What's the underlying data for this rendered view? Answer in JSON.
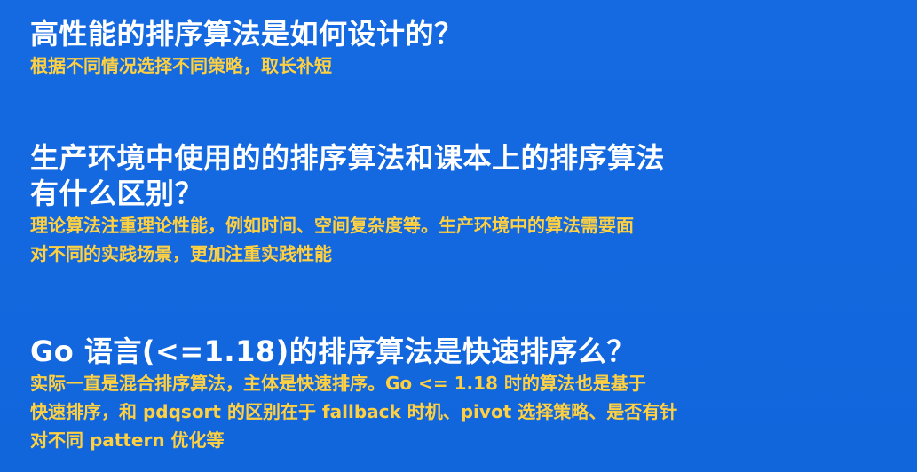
{
  "sections": [
    {
      "question": "高性能的排序算法是如何设计的？",
      "answer": "根据不同情况选择不同策略，取长补短"
    },
    {
      "question_lines": [
        "生产环境中使用的的排序算法和课本上的排序算法",
        "有什么区别？"
      ],
      "answer_lines": [
        "理论算法注重理论性能，例如时间、空间复杂度等。生产环境中的算法需要面",
        "对不同的实践场景，更加注重实践性能"
      ]
    },
    {
      "question": "Go 语言(<=1.18)的排序算法是快速排序么？",
      "answer_lines": [
        "实际一直是混合排序算法，主体是快速排序。Go <= 1.18 时的算法也是基于",
        "快速排序，和 pdqsort 的区别在于 fallback 时机、pivot 选择策略、是否有针",
        "对不同 pattern 优化等"
      ]
    }
  ],
  "colors": {
    "background": "#1469e0",
    "question_text": "#ffffff",
    "answer_text": "#ffd040"
  }
}
